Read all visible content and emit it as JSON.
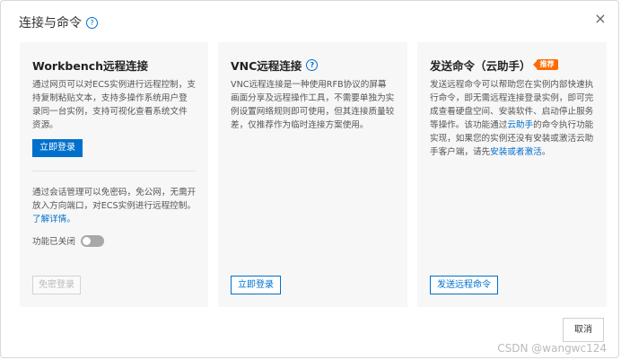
{
  "dialog": {
    "title": "连接与命令",
    "help_icon": "question-circle-icon",
    "close_glyph": "×",
    "cancel_label": "取消"
  },
  "cards": [
    {
      "title": "Workbench远程连接",
      "desc": "通过网页可以对ECS实例进行远程控制，支持复制粘贴文本，支持多操作系统用户登录同一台实例，支持可视化查看系统文件资源。",
      "primary_button": "立即登录",
      "secondary_desc": "通过会话管理可以免密码，免公网，无需开放入方向端口，对ECS实例进行远程控制。",
      "secondary_link": "了解详情。",
      "toggle_label": "功能已关闭",
      "disabled_button": "免密登录"
    },
    {
      "title": "VNC远程连接",
      "desc": "VNC远程连接是一种使用RFB协议的屏幕画面分享及远程操作工具，不需要单独为实例设置网络规则即可使用，但其连接质量较差，仅推荐作为临时连接方案使用。",
      "button": "立即登录"
    },
    {
      "title": "发送命令（云助手）",
      "badge": "推荐",
      "desc_before": "发送远程命令可以帮助您在实例内部快速执行命令，即无需远程连接登录实例，即可完成查看硬盘空间、安装软件、启动停止服务等操作。该功能通过",
      "link1": "云助手",
      "desc_mid": "的命令执行功能实现，如果您的实例还没有安装或激活云助手客户端，请先",
      "link2": "安装或者激活",
      "desc_end": "。",
      "button": "发送远程命令"
    }
  ],
  "watermark": "CSDN @wangwc124",
  "colors": {
    "primary": "#0070cc",
    "badge": "#ff6a00",
    "card_bg": "#f7f7f7"
  }
}
